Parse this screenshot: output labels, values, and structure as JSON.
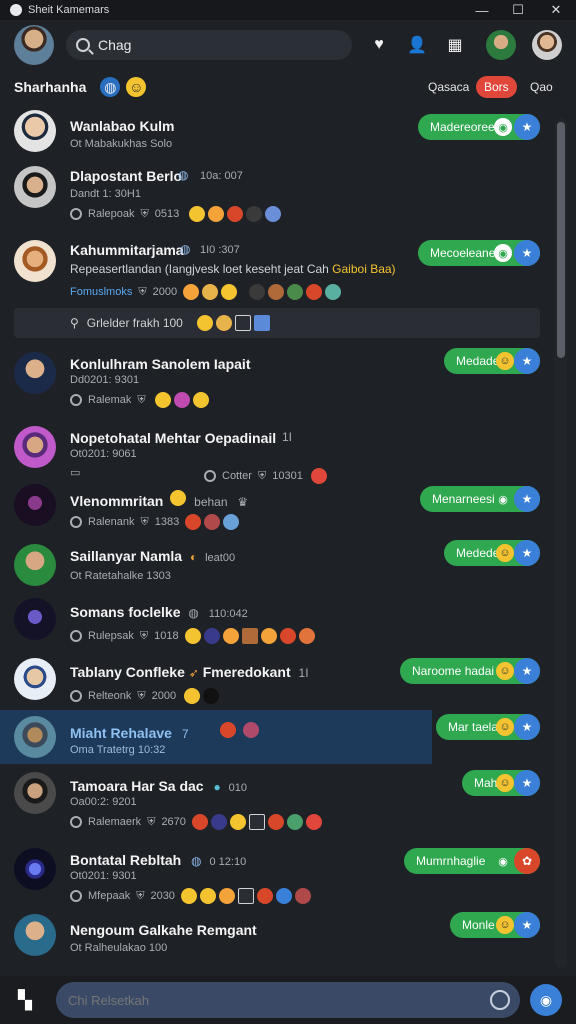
{
  "window": {
    "title": "Sheit Kamemars"
  },
  "header": {
    "search_value": "Chag"
  },
  "filters": {
    "title": "Sharhanha",
    "left_btn": "Qasaca",
    "active_btn": "Bors",
    "right_btn": "Qao"
  },
  "conversations": [
    {
      "name": "Wanlabao Kulm",
      "sub": "Ot Mabakukhas Solo",
      "meta": "",
      "pill": "Madereoree"
    },
    {
      "name": "Dlapostant Berlo",
      "sub": "Dandt 1: 30H1",
      "meta": "Ralepoak",
      "meta_time": "0513",
      "pill": ""
    },
    {
      "name": "Kahummitarjama",
      "sub": "Repeasertlandan (Iangjvesk loet keseht jeat Cah",
      "sub_accent": "Gaiboi Baa)",
      "meta": "Fomuslmoks",
      "meta_time": "2000",
      "pill": "Mecoeleane"
    },
    {
      "name": "Konlulhram Sanolem Iapait",
      "sub": "Dd0201: 9301",
      "meta": "Ralemak",
      "meta_time": "",
      "pill": "Medade"
    },
    {
      "name": "Nopetohatal Mehtar Oepadinail",
      "sub": "Ot0201: 9061",
      "meta": "Cotter",
      "meta_time": "10301",
      "pill": ""
    },
    {
      "name": "Vlenommritan",
      "name_suffix": "behan",
      "sub": "",
      "meta": "Ralenank",
      "meta_time": "1383",
      "pill": "Menarneesie"
    },
    {
      "name": "Saillanyar Namla",
      "name_suffix": "leat00",
      "sub": "Ot Ratetahalke 1303",
      "meta": "",
      "meta_time": "",
      "pill": "Medede"
    },
    {
      "name": "Somans foclelke",
      "name_suffix": "110:042",
      "sub": "",
      "meta": "Rulepsak",
      "meta_time": "1018",
      "pill": ""
    },
    {
      "name": "Tablany Confleke",
      "name_suffix": "Fmeredokant",
      "sub": "",
      "meta": "Relteonk",
      "meta_time": "2000",
      "pill": "Naroome hadai"
    },
    {
      "name": "Miaht Rehalave",
      "sub": "Oma Tratetrg 10:32",
      "meta": "",
      "meta_time": "",
      "pill": "Mar taela"
    },
    {
      "name": "Tamoara Har Sa dac",
      "name_suffix": "010",
      "sub": "Oa00:2: 9201",
      "meta": "Ralemaerk",
      "meta_time": "2670",
      "pill": "Mah"
    },
    {
      "name": "Bontatal Rebltah",
      "name_suffix": "0 12:10",
      "sub": "Ot0201: 9301",
      "meta": "Mfepaak",
      "meta_time": "2030",
      "pill": "Mumrnhaglie"
    },
    {
      "name": "Nengoum Galkahe Remgant",
      "sub": "Ot Ralheulakao 100",
      "meta": "",
      "meta_time": "",
      "pill": "Monle"
    }
  ],
  "banner": {
    "text": "Grlelder frakh 100"
  },
  "composer": {
    "placeholder": "Chi Relsetkah"
  },
  "colors": {
    "pill": "#2fa84f",
    "accent_blue": "#3a7fd8",
    "active_filter": "#e0473a",
    "highlight_row": "#1d3a5b"
  }
}
